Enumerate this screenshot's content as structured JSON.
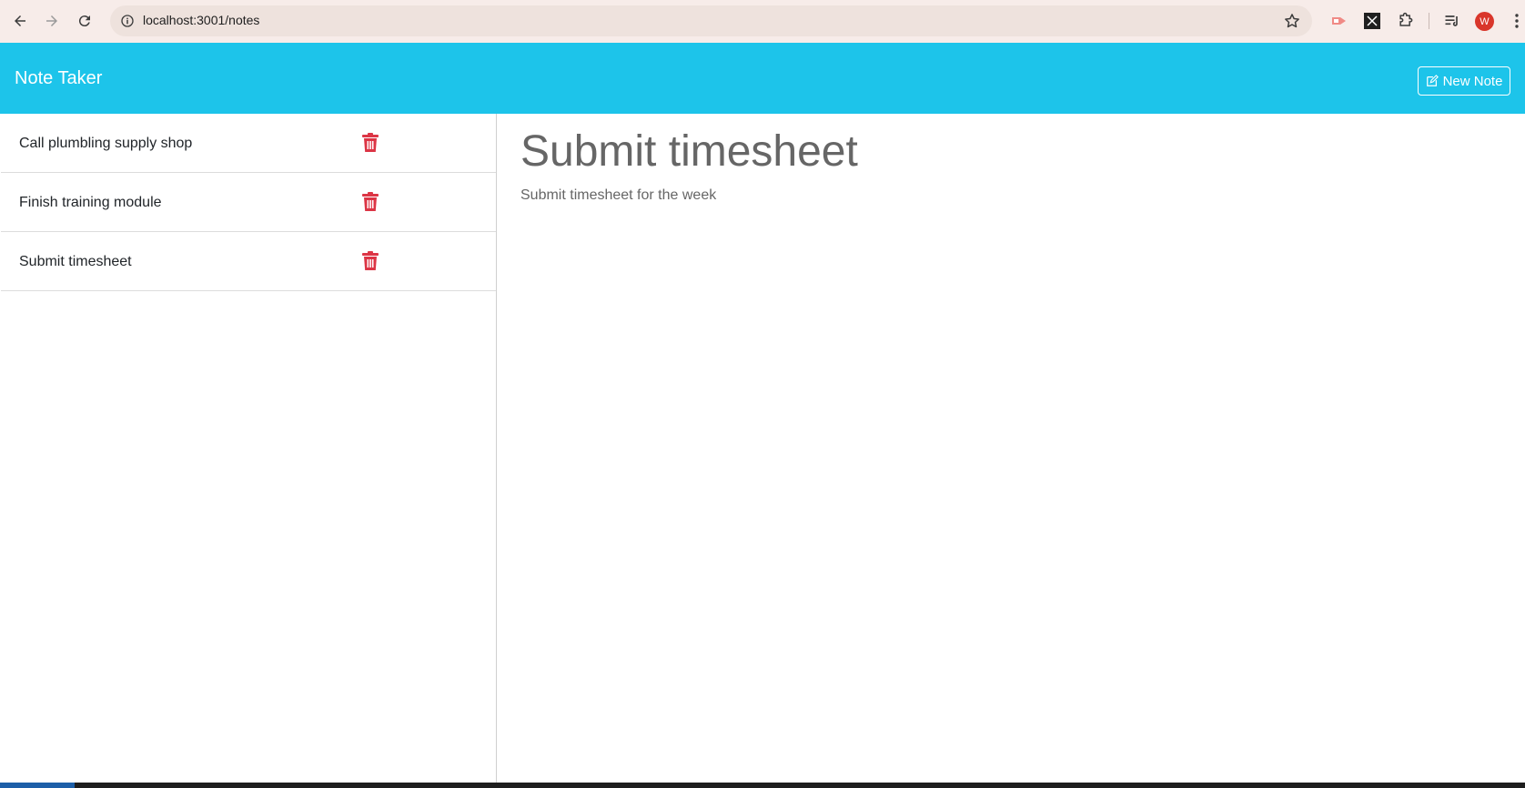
{
  "browser": {
    "url": "localhost:3001/notes",
    "avatar_letter": "W"
  },
  "app": {
    "brand": "Note Taker",
    "new_note_label": "New Note"
  },
  "notes": [
    {
      "title": "Call plumbling supply shop"
    },
    {
      "title": "Finish training module"
    },
    {
      "title": "Submit timesheet"
    }
  ],
  "active_note": {
    "title": "Submit timesheet",
    "text": "Submit timesheet for the week"
  },
  "colors": {
    "header": "#1dc4ea",
    "trash": "#dc3545",
    "note_text": "#666666"
  }
}
